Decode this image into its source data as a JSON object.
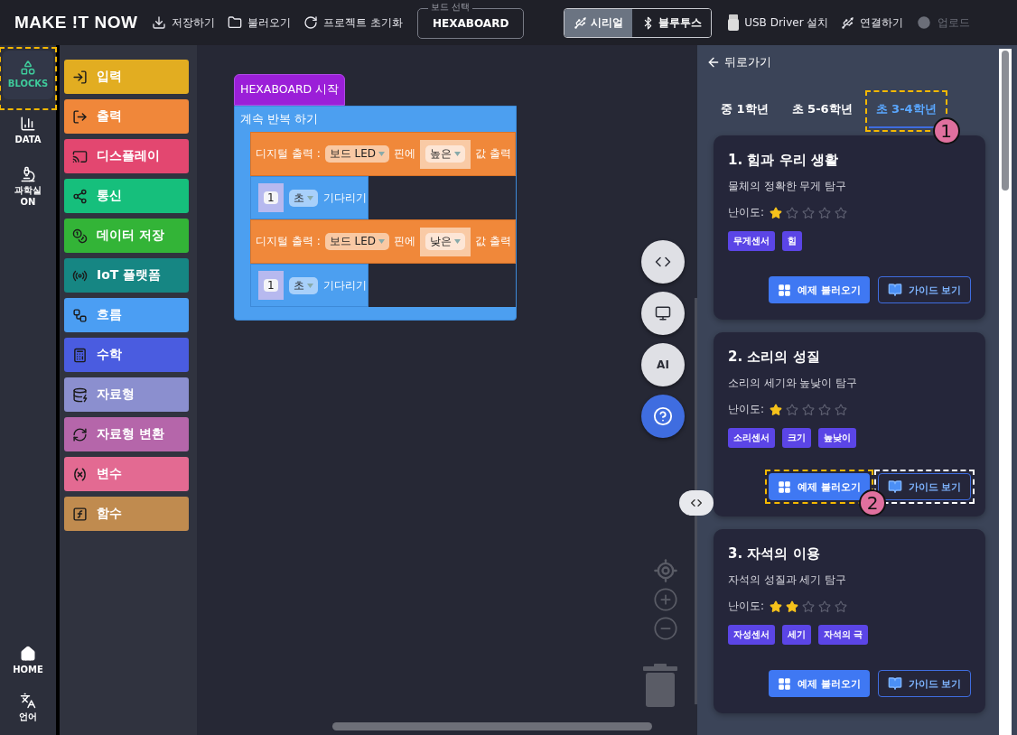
{
  "top_bar": {
    "logo": "MAKE !T NOW",
    "actions": [
      {
        "label": "저장하기"
      },
      {
        "label": "불러오기"
      },
      {
        "label": "프로젝트 초기화"
      }
    ],
    "board_select": {
      "legend": "보드 선택",
      "value": "HEXABOARD"
    },
    "connection_modes": [
      {
        "label": "시리얼",
        "selected": true
      },
      {
        "label": "블루투스",
        "selected": false
      }
    ],
    "tools": [
      {
        "label": "USB Driver 설치",
        "disabled": false
      },
      {
        "label": "연결하기",
        "disabled": false
      },
      {
        "label": "업로드",
        "disabled": true
      }
    ]
  },
  "sidebar": {
    "items": [
      {
        "label": "BLOCKS",
        "selected": true,
        "callout": {
          "color": "#f5b800"
        }
      },
      {
        "label": "DATA",
        "selected": false
      },
      {
        "label": "과학실\nON",
        "selected": false
      }
    ],
    "bottom_items": [
      {
        "label": "HOME"
      },
      {
        "label": "언어"
      }
    ]
  },
  "categories": [
    {
      "label": "입력",
      "color": "#e2ad21"
    },
    {
      "label": "출력",
      "color": "#f0873a"
    },
    {
      "label": "디스플레이",
      "color": "#e34770"
    },
    {
      "label": "통신",
      "color": "#16bf7c"
    },
    {
      "label": "데이터 저장",
      "color": "#33b437"
    },
    {
      "label": "IoT 플랫폼",
      "color": "#168683"
    },
    {
      "label": "흐름",
      "color": "#4b9ef3"
    },
    {
      "label": "수학",
      "color": "#4a5ce0"
    },
    {
      "label": "자료형",
      "color": "#8b8fcf"
    },
    {
      "label": "자료형 변환",
      "color": "#b566aa"
    },
    {
      "label": "변수",
      "color": "#e36a92"
    },
    {
      "label": "함수",
      "color": "#c08b4f"
    }
  ],
  "workspace": {
    "start_block": "HEXABOARD 시작",
    "loop": {
      "label": "계속 반복 하기",
      "statements": [
        {
          "kind": "digital-write",
          "label": "디지털 출력 :",
          "pin": "보드 LED",
          "middle": "핀에",
          "value": "높은",
          "suffix": "값 출력"
        },
        {
          "kind": "wait",
          "number": "1",
          "unit": "초",
          "label": "기다리기"
        },
        {
          "kind": "digital-write",
          "label": "디지털 출력 :",
          "pin": "보드 LED",
          "middle": "핀에",
          "value": "낮은",
          "suffix": "값 출력"
        },
        {
          "kind": "wait",
          "number": "1",
          "unit": "초",
          "label": "기다리기"
        }
      ]
    },
    "side_buttons": [
      {
        "kind": "code"
      },
      {
        "kind": "monitor"
      },
      {
        "kind": "text",
        "label": "AI"
      },
      {
        "kind": "help"
      }
    ]
  },
  "examples_panel": {
    "back": "뒤로가기",
    "tabs": [
      {
        "label": "중 1학년",
        "selected": false
      },
      {
        "label": "초 5-6학년",
        "selected": false
      },
      {
        "label": "초 3-4학년",
        "selected": true,
        "callout": {
          "color": "#f5b800",
          "badge": "1"
        }
      }
    ],
    "cards": [
      {
        "title": "1. 힘과 우리 생활",
        "description": "물체의 정확한 무게 탐구",
        "difficulty_label": "난이도:",
        "stars": 1,
        "tags": [
          "무게센서",
          "힘"
        ],
        "load_button": {
          "label": "예제 불러오기"
        },
        "guide_button": {
          "label": "가이드 보기"
        }
      },
      {
        "title": "2. 소리의 성질",
        "description": "소리의 세기와 높낮이 탐구",
        "difficulty_label": "난이도:",
        "stars": 1,
        "tags": [
          "소리센서",
          "크기",
          "높낮이"
        ],
        "load_button": {
          "label": "예제 불러오기",
          "callout": {
            "color": "#f5b800",
            "badge": "2"
          }
        },
        "guide_button": {
          "label": "가이드 보기",
          "callout": {
            "color": "#ffffff"
          }
        }
      },
      {
        "title": "3. 자석의 이용",
        "description": "자석의 성질과 세기 탐구",
        "difficulty_label": "난이도:",
        "stars": 2,
        "tags": [
          "자성센서",
          "세기",
          "자석의 극"
        ],
        "load_button": {
          "label": "예제 불러오기"
        },
        "guide_button": {
          "label": "가이드 보기"
        }
      }
    ]
  }
}
